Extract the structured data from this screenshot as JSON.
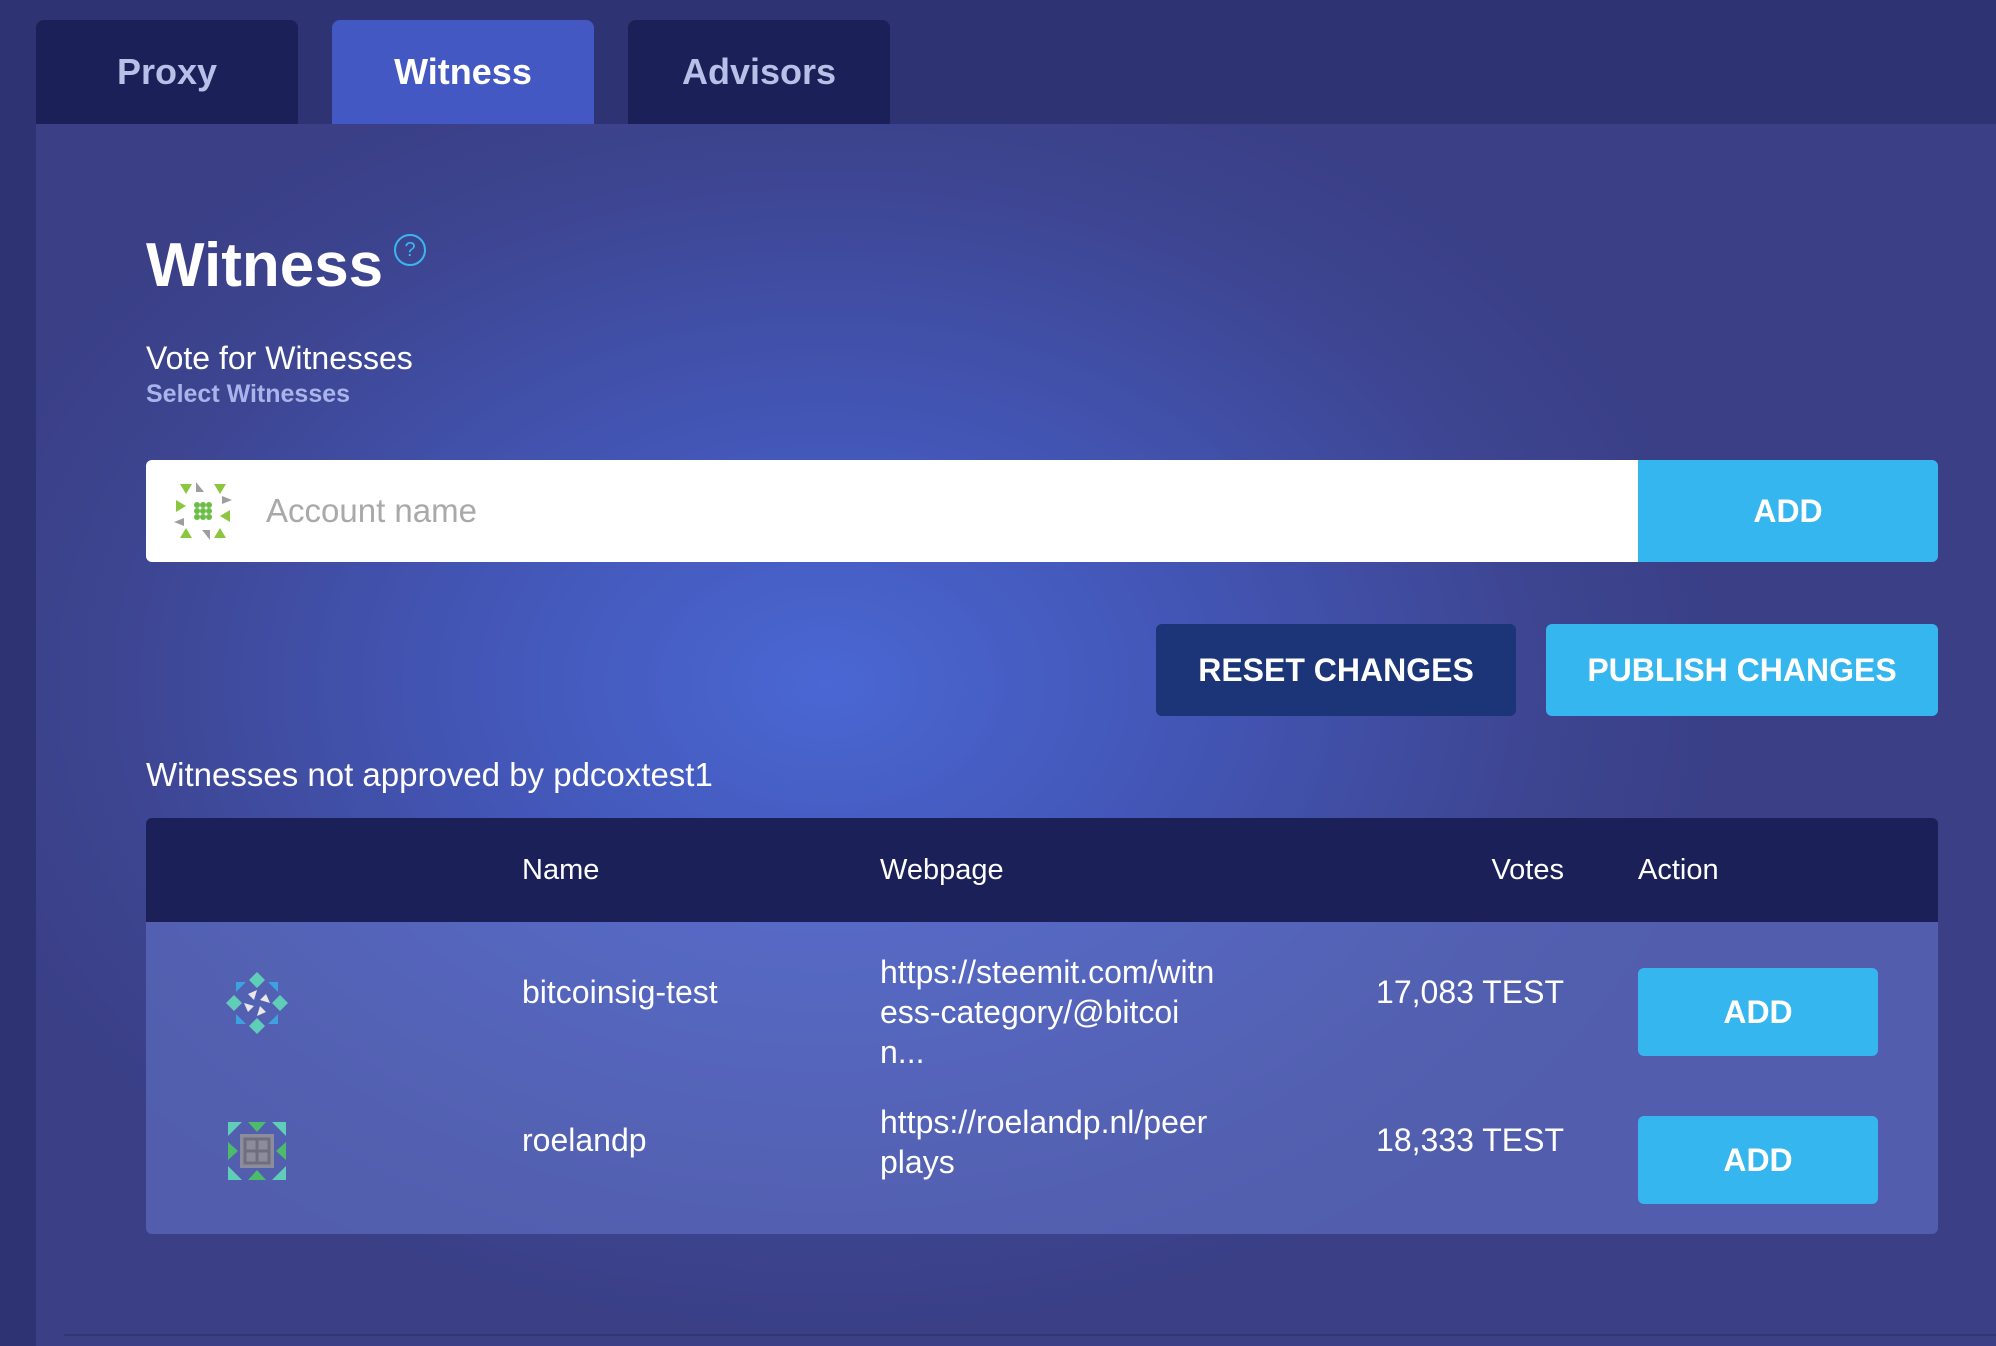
{
  "tabs": [
    {
      "label": "Proxy",
      "active": false
    },
    {
      "label": "Witness",
      "active": true
    },
    {
      "label": "Advisors",
      "active": false
    }
  ],
  "page": {
    "title": "Witness",
    "help_icon": "?",
    "section_title": "Vote for Witnesses",
    "section_subtitle": "Select Witnesses"
  },
  "search": {
    "placeholder": "Account name",
    "value": "",
    "add_label": "ADD"
  },
  "actions": {
    "reset_label": "RESET CHANGES",
    "publish_label": "PUBLISH CHANGES"
  },
  "list": {
    "title": "Witnesses not approved by pdcoxtest1",
    "columns": {
      "name": "Name",
      "webpage": "Webpage",
      "votes": "Votes",
      "action": "Action"
    },
    "rows": [
      {
        "name": "bitcoinsig-test",
        "webpage": "https://steemit.com/witness-category/@bitcoin...",
        "votes": "17,083 TEST",
        "action": "ADD"
      },
      {
        "name": "roelandp",
        "webpage": "https://roelandp.nl/peerplays",
        "votes": "18,333 TEST",
        "action": "ADD"
      }
    ]
  },
  "colors": {
    "accent": "#36b6ee",
    "tab_active": "#4358c3",
    "tab_inactive": "#1b2058",
    "reset_button": "#1c3478",
    "table_header": "#1b2058"
  }
}
